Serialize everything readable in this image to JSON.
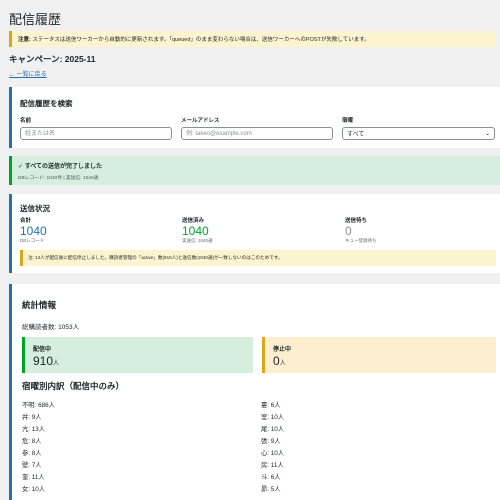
{
  "page": {
    "title": "配信履歴",
    "notice_label": "注意:",
    "notice_text": " ステータスは送信ワーカーから自動的に更新されます。「queued」のまま変わらない場合は、送信ワーカーへのPOSTが失敗しています。",
    "campaign": "キャンペーン: 2025-11",
    "back_link": "← 一覧に戻る"
  },
  "search": {
    "title": "配信履歴を検索",
    "name_label": "名前",
    "name_placeholder": "姓または名",
    "email_label": "メールアドレス",
    "email_placeholder": "例: takeo@example.com",
    "mansion_label": "宿曜",
    "mansion_value": "すべて"
  },
  "success": {
    "title": "✓ すべての送信が完了しました",
    "sub": "DBレコード: 1040件 | 実送信: 1040通"
  },
  "status": {
    "title": "送信状況",
    "total_label": "合計",
    "total_value": "1040",
    "total_sub": "DBレコード",
    "sent_label": "送信済み",
    "sent_value": "1040",
    "sent_sub": "実送信: 1040通",
    "pending_label": "送信待ち",
    "pending_value": "0",
    "pending_sub": "キュー登録待ち",
    "warning": "注: 12人が配信後に配信停止しました。購読者管理の「active」数(910人)と送信数(1040通)が一致しないのはこのためです。"
  },
  "stats": {
    "title": "統計情報",
    "total": "総購読者数: 1053人",
    "active_label": "配信中",
    "active_value": "910",
    "active_unit": "人",
    "stopped_label": "停止中",
    "stopped_value": "0",
    "stopped_unit": "人",
    "breakdown_title": "宿曜別内訳（配信中のみ）",
    "left": [
      "不明: 686人",
      "井: 9人",
      "亢: 13人",
      "危: 8人",
      "参: 8人",
      "壁: 7人",
      "奎: 11人",
      "女: 10人"
    ],
    "right": [
      "婁: 6人",
      "室: 10人",
      "尾: 10人",
      "張: 9人",
      "心: 10人",
      "房: 11人",
      "斗: 6人",
      "昴: 5人"
    ]
  },
  "colors": {
    "accent": "#2271b1",
    "success": "#00a32a",
    "warning": "#dba617"
  }
}
